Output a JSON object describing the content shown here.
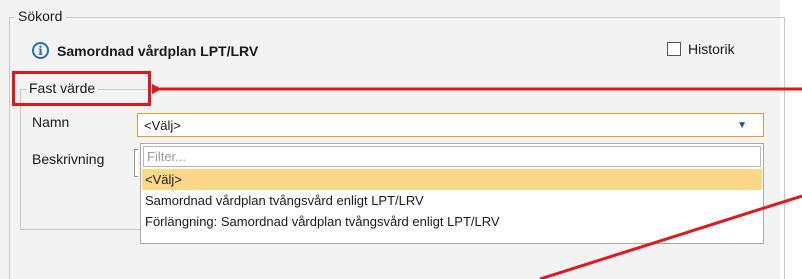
{
  "fieldset": {
    "legend": "Sökord"
  },
  "header": {
    "info_icon": "info-circle-icon",
    "title": "Samordnad vårdplan LPT/LRV"
  },
  "historik": {
    "label": "Historik",
    "checked": false
  },
  "fast_varde": {
    "legend": "Fast värde",
    "name_label": "Namn",
    "select_value": "<Välj>",
    "description_label": "Beskrivning",
    "dropdown": {
      "filter_placeholder": "Filter...",
      "options": [
        "<Välj>",
        "Samordnad vårdplan tvångsvård enligt LPT/LRV",
        "Förlängning: Samordnad vårdplan tvångsvård enligt LPT/LRV"
      ],
      "selected_index": 0
    }
  },
  "colors": {
    "highlight": "#fbd788",
    "annotation_red": "#e0171e",
    "info_blue": "#2a6cb0",
    "select_border": "#e59a3a"
  }
}
